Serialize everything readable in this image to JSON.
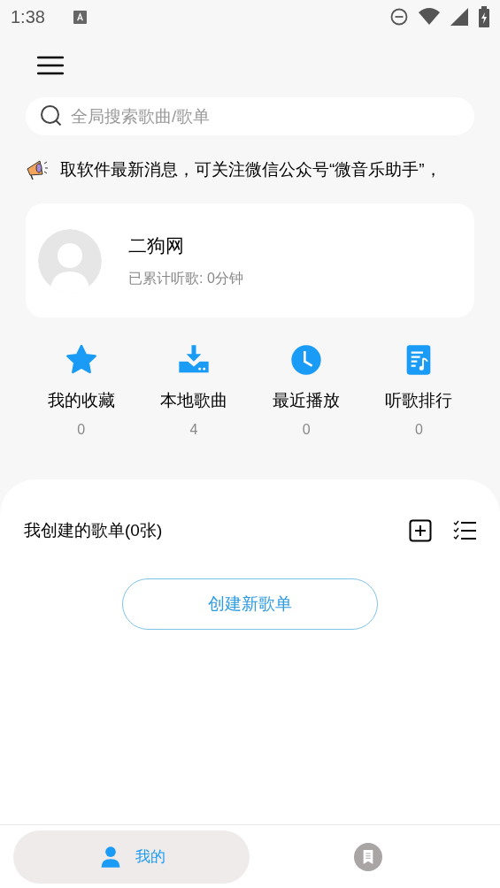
{
  "status_bar": {
    "time": "1:38"
  },
  "search": {
    "placeholder": "全局搜索歌曲/歌单"
  },
  "notice": {
    "text": "取软件最新消息，可关注微信公众号“微音乐助手”，"
  },
  "profile": {
    "name": "二狗网",
    "listen_time": "已累计听歌: 0分钟"
  },
  "shortcuts": [
    {
      "kind": "star",
      "label": "我的收藏",
      "count": "0"
    },
    {
      "kind": "download",
      "label": "本地歌曲",
      "count": "4"
    },
    {
      "kind": "clock",
      "label": "最近播放",
      "count": "0"
    },
    {
      "kind": "chart",
      "label": "听歌排行",
      "count": "0"
    }
  ],
  "playlists": {
    "title": "我创建的歌单(0张)",
    "create_button": "创建新歌单"
  },
  "bottom_nav": [
    {
      "kind": "person",
      "label": "我的",
      "selected": true
    },
    {
      "kind": "bookmark",
      "selected": false
    }
  ]
}
